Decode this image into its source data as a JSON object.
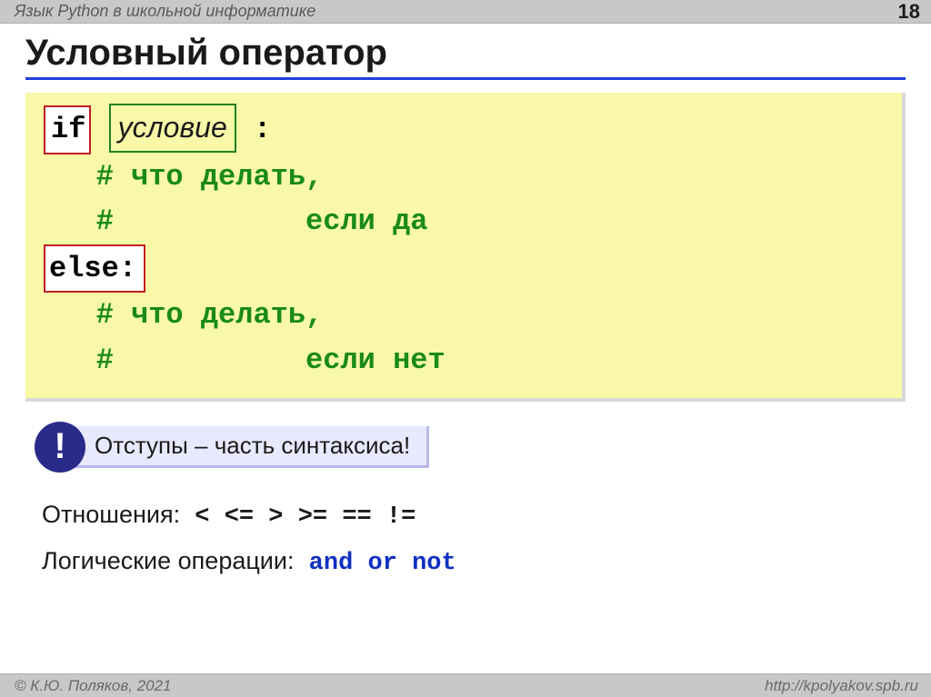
{
  "header": {
    "title": "Язык Python в школьной  информатике",
    "page": "18"
  },
  "slide": {
    "title": "Условный оператор"
  },
  "code": {
    "if_kw": "if",
    "condition": "условие",
    "colon": " :",
    "comment_yes1": "   # что делать,",
    "comment_yes2": "   #           если да",
    "else_kw": "else:",
    "comment_no1": "   # что делать,",
    "comment_no2": "   #           если нет"
  },
  "note": {
    "badge": "!",
    "text": "Отступы – часть синтаксиса!"
  },
  "ops": {
    "rel_label": "Отношения:",
    "rel_ops": " <  <=  >  >=  ==  !=",
    "logic_label": "Логические операции:",
    "logic_and": "  and",
    "logic_or": "  or",
    "logic_not": "  not"
  },
  "footer": {
    "left": "© К.Ю. Поляков, 2021",
    "right": "http://kpolyakov.spb.ru"
  }
}
